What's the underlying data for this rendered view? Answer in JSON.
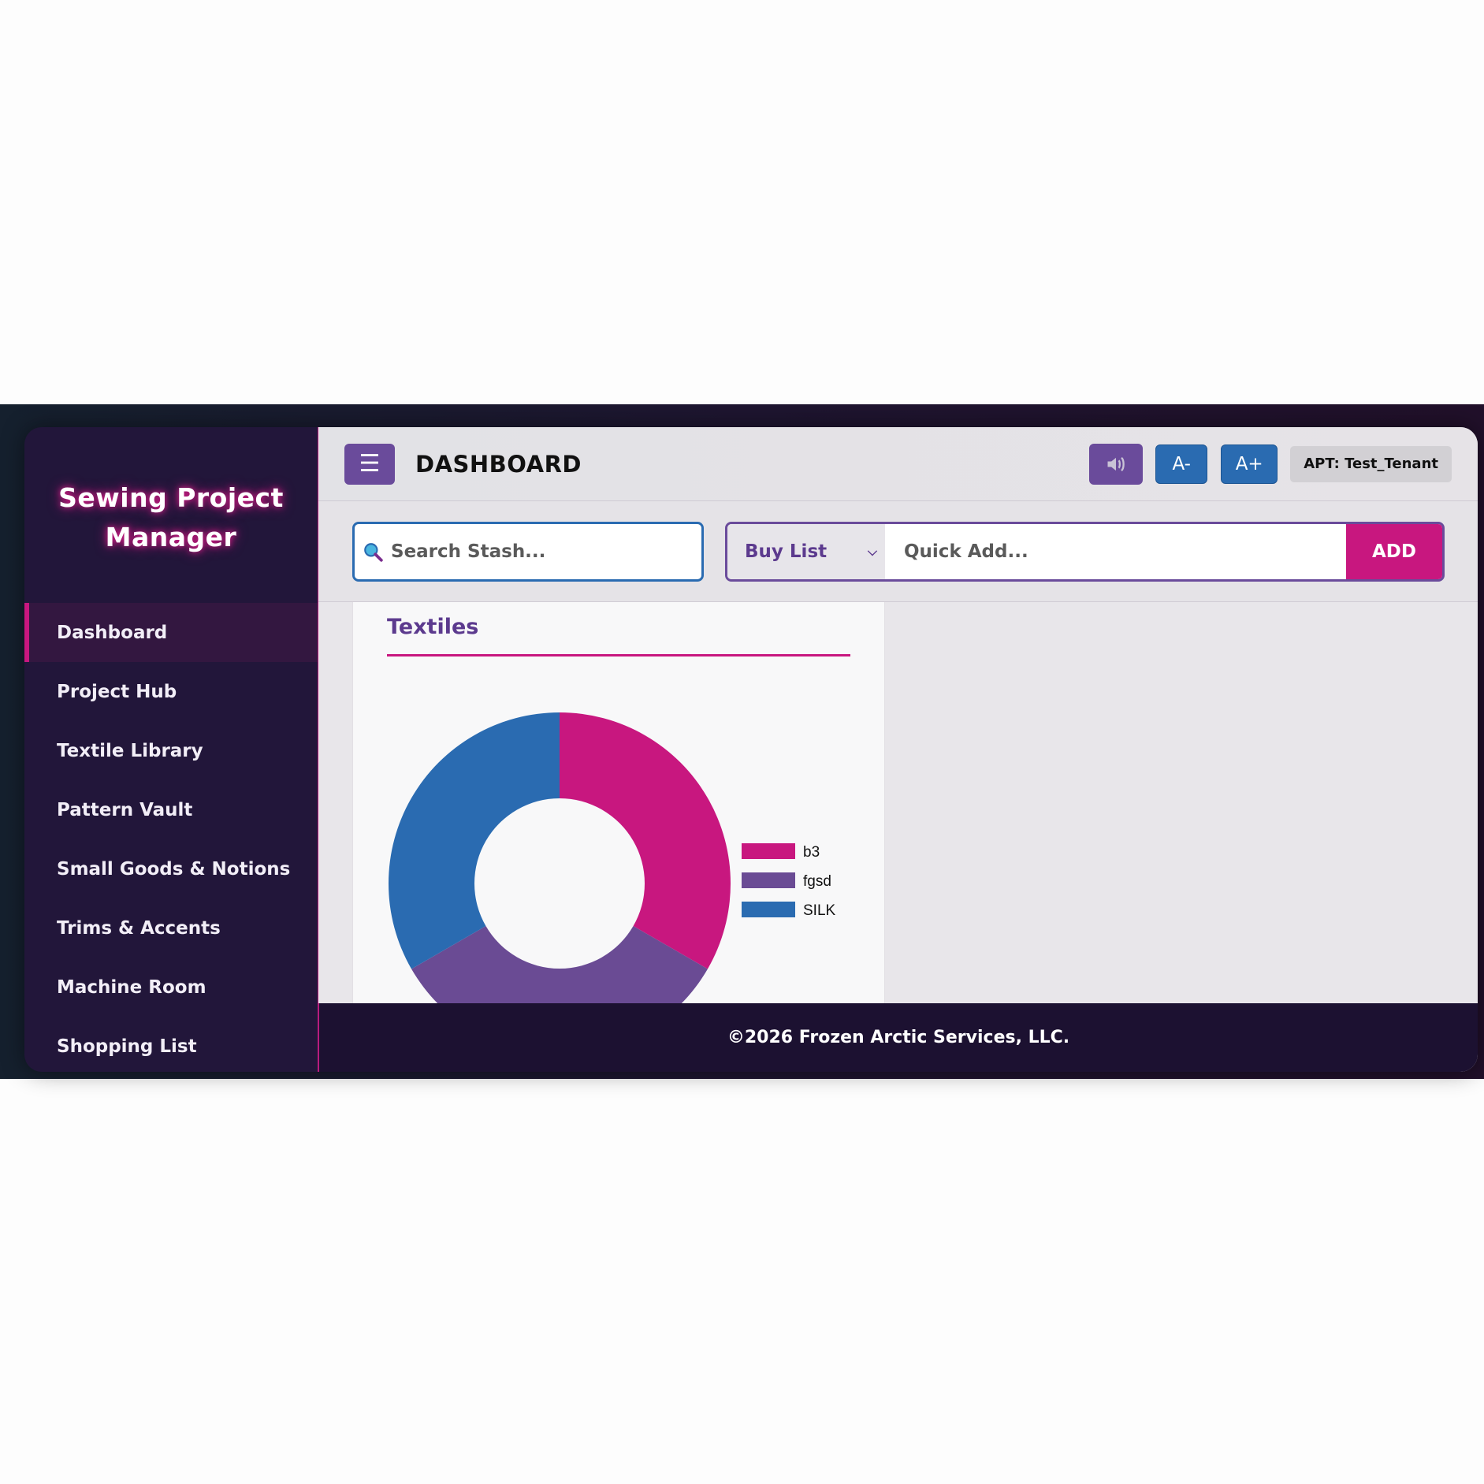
{
  "app": {
    "title_line1": "Sewing Project",
    "title_line2": "Manager"
  },
  "sidebar": {
    "items": [
      {
        "label": "Dashboard",
        "active": true
      },
      {
        "label": "Project Hub"
      },
      {
        "label": "Textile Library"
      },
      {
        "label": "Pattern Vault"
      },
      {
        "label": "Small Goods & Notions"
      },
      {
        "label": "Trims & Accents"
      },
      {
        "label": "Machine Room"
      },
      {
        "label": "Shopping List"
      }
    ]
  },
  "header": {
    "menu_icon": "hamburger-icon",
    "title": "DASHBOARD",
    "sound_icon": "speaker-icon",
    "font_decrease": "A-",
    "font_increase": "A+",
    "tenant": "APT: Test_Tenant"
  },
  "toolbar": {
    "search_placeholder": "Search Stash...",
    "list_select": "Buy List",
    "quick_add_placeholder": "Quick Add...",
    "add_label": "ADD"
  },
  "card": {
    "title": "Textiles"
  },
  "chart_data": {
    "type": "pie",
    "donut": true,
    "title": "",
    "legend_position": "right",
    "slices": [
      {
        "label": "b3",
        "value": 1,
        "color": "#c8177f"
      },
      {
        "label": "fgsd",
        "value": 1,
        "color": "#6a4b94"
      },
      {
        "label": "SILK",
        "value": 1,
        "color": "#2a6bb1"
      }
    ]
  },
  "footer": {
    "text": "©2026 Frozen Arctic Services, LLC."
  },
  "colors": {
    "accent_pink": "#c8177f",
    "accent_purple": "#6a4b9b",
    "accent_blue": "#2a6bb1",
    "sidebar_bg": "#22163a"
  }
}
